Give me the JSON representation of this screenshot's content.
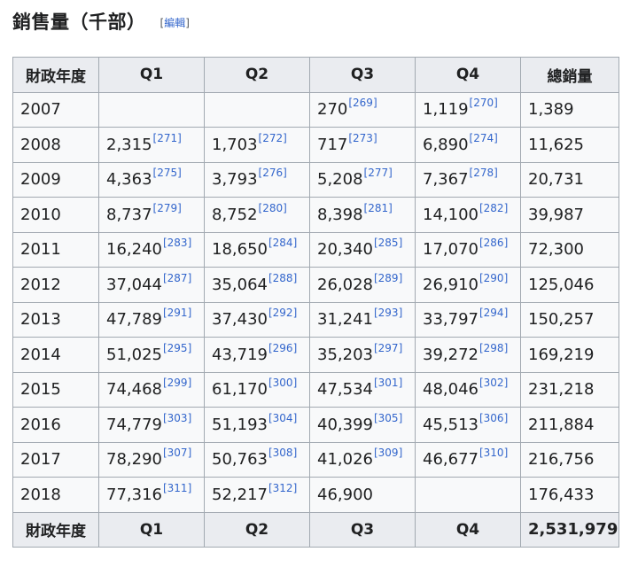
{
  "heading": {
    "title": "銷售量（千部）",
    "edit_open": "[",
    "edit_label": "編輯",
    "edit_close": "]"
  },
  "table": {
    "headers": [
      "財政年度",
      "Q1",
      "Q2",
      "Q3",
      "Q4",
      "總銷量"
    ],
    "rows": [
      {
        "year": "2007",
        "q1": "",
        "q1_ref": "",
        "q2": "",
        "q2_ref": "",
        "q3": "270",
        "q3_ref": "[269]",
        "q4": "1,119",
        "q4_ref": "[270]",
        "total": "1,389"
      },
      {
        "year": "2008",
        "q1": "2,315",
        "q1_ref": "[271]",
        "q2": "1,703",
        "q2_ref": "[272]",
        "q3": "717",
        "q3_ref": "[273]",
        "q4": "6,890",
        "q4_ref": "[274]",
        "total": "11,625"
      },
      {
        "year": "2009",
        "q1": "4,363",
        "q1_ref": "[275]",
        "q2": "3,793",
        "q2_ref": "[276]",
        "q3": "5,208",
        "q3_ref": "[277]",
        "q4": "7,367",
        "q4_ref": "[278]",
        "total": "20,731"
      },
      {
        "year": "2010",
        "q1": "8,737",
        "q1_ref": "[279]",
        "q2": "8,752",
        "q2_ref": "[280]",
        "q3": "8,398",
        "q3_ref": "[281]",
        "q4": "14,100",
        "q4_ref": "[282]",
        "total": "39,987"
      },
      {
        "year": "2011",
        "q1": "16,240",
        "q1_ref": "[283]",
        "q2": "18,650",
        "q2_ref": "[284]",
        "q3": "20,340",
        "q3_ref": "[285]",
        "q4": "17,070",
        "q4_ref": "[286]",
        "total": "72,300"
      },
      {
        "year": "2012",
        "q1": "37,044",
        "q1_ref": "[287]",
        "q2": "35,064",
        "q2_ref": "[288]",
        "q3": "26,028",
        "q3_ref": "[289]",
        "q4": "26,910",
        "q4_ref": "[290]",
        "total": "125,046"
      },
      {
        "year": "2013",
        "q1": "47,789",
        "q1_ref": "[291]",
        "q2": "37,430",
        "q2_ref": "[292]",
        "q3": "31,241",
        "q3_ref": "[293]",
        "q4": "33,797",
        "q4_ref": "[294]",
        "total": "150,257"
      },
      {
        "year": "2014",
        "q1": "51,025",
        "q1_ref": "[295]",
        "q2": "43,719",
        "q2_ref": "[296]",
        "q3": "35,203",
        "q3_ref": "[297]",
        "q4": "39,272",
        "q4_ref": "[298]",
        "total": "169,219"
      },
      {
        "year": "2015",
        "q1": "74,468",
        "q1_ref": "[299]",
        "q2": "61,170",
        "q2_ref": "[300]",
        "q3": "47,534",
        "q3_ref": "[301]",
        "q4": "48,046",
        "q4_ref": "[302]",
        "total": "231,218"
      },
      {
        "year": "2016",
        "q1": "74,779",
        "q1_ref": "[303]",
        "q2": "51,193",
        "q2_ref": "[304]",
        "q3": "40,399",
        "q3_ref": "[305]",
        "q4": "45,513",
        "q4_ref": "[306]",
        "total": "211,884"
      },
      {
        "year": "2017",
        "q1": "78,290",
        "q1_ref": "[307]",
        "q2": "50,763",
        "q2_ref": "[308]",
        "q3": "41,026",
        "q3_ref": "[309]",
        "q4": "46,677",
        "q4_ref": "[310]",
        "total": "216,756"
      },
      {
        "year": "2018",
        "q1": "77,316",
        "q1_ref": "[311]",
        "q2": "52,217",
        "q2_ref": "[312]",
        "q3": "46,900",
        "q3_ref": "",
        "q4": "",
        "q4_ref": "",
        "total": "176,433"
      }
    ],
    "footer": [
      "財政年度",
      "Q1",
      "Q2",
      "Q3",
      "Q4",
      "2,531,979"
    ]
  }
}
